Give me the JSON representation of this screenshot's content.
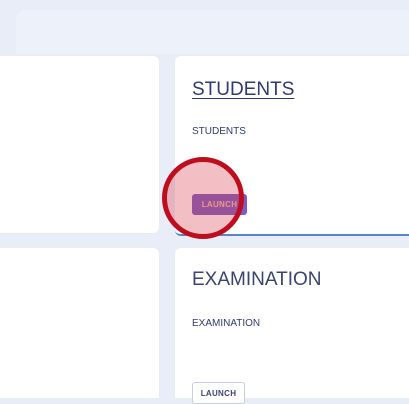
{
  "cards": [
    {
      "title": "STUDENTS",
      "description": "STUDENTS",
      "button_label": "LAUNCH"
    },
    {
      "title": "EXAMINATION",
      "description": "EXAMINATION",
      "button_label": "LAUNCH"
    }
  ],
  "colors": {
    "page_bg": "#e9edf8",
    "card_bg": "#ffffff",
    "title_text": "#2f3a73",
    "active_button_bg": "#7b5dc2",
    "active_button_text": "#f4c3a7",
    "active_card_underline": "#5b85c9",
    "highlight_ring": "#c00d1e"
  }
}
